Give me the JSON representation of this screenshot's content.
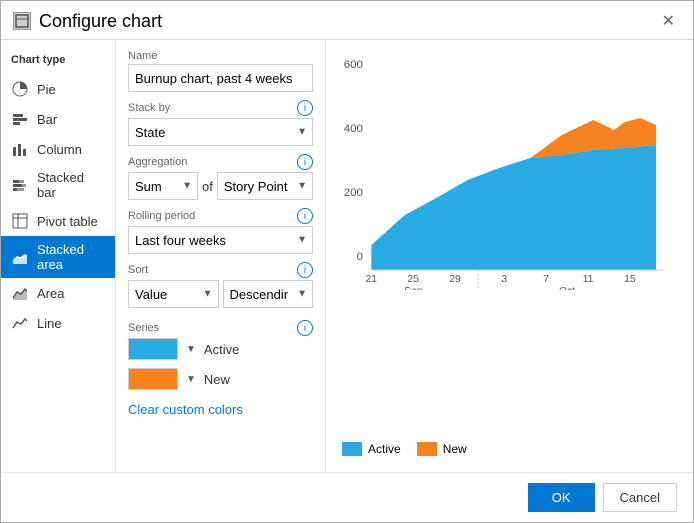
{
  "dialog": {
    "title": "Configure chart",
    "close_label": "✕"
  },
  "chart_type_section": {
    "label": "Chart type",
    "items": [
      {
        "id": "pie",
        "label": "Pie",
        "icon": "pie"
      },
      {
        "id": "bar",
        "label": "Bar",
        "icon": "bar"
      },
      {
        "id": "column",
        "label": "Column",
        "icon": "column"
      },
      {
        "id": "stacked-bar",
        "label": "Stacked bar",
        "icon": "stacked-bar"
      },
      {
        "id": "pivot-table",
        "label": "Pivot table",
        "icon": "pivot"
      },
      {
        "id": "stacked-area",
        "label": "Stacked area",
        "icon": "stacked-area",
        "active": true
      },
      {
        "id": "area",
        "label": "Area",
        "icon": "area"
      },
      {
        "id": "line",
        "label": "Line",
        "icon": "line"
      }
    ]
  },
  "config": {
    "name_label": "Name",
    "name_value": "Burnup chart, past 4 weeks",
    "name_placeholder": "Burnup chart, past 4 weeks",
    "stack_by_label": "Stack by",
    "stack_by_value": "State",
    "aggregation_label": "Aggregation",
    "aggregation_func": "Sum",
    "aggregation_of": "of",
    "aggregation_field": "Story Points",
    "rolling_label": "Rolling period",
    "rolling_value": "Last four weeks",
    "sort_label": "Sort",
    "sort_by": "Value",
    "sort_dir": "Descending",
    "series_label": "Series",
    "series_items": [
      {
        "label": "Active",
        "color": "#29abe2"
      },
      {
        "label": "New",
        "color": "#f5821f"
      }
    ],
    "clear_link": "Clear custom colors"
  },
  "chart": {
    "y_ticks": [
      "600",
      "400",
      "200",
      "0"
    ],
    "x_labels": [
      "21",
      "25",
      "29",
      "3",
      "7",
      "11",
      "15"
    ],
    "x_groups": [
      "Sep",
      "Oct"
    ],
    "active_color": "#29abe2",
    "new_color": "#f5821f"
  },
  "legend": {
    "items": [
      {
        "label": "Active",
        "color": "#29abe2"
      },
      {
        "label": "New",
        "color": "#f5821f"
      }
    ]
  },
  "footer": {
    "ok_label": "OK",
    "cancel_label": "Cancel"
  }
}
